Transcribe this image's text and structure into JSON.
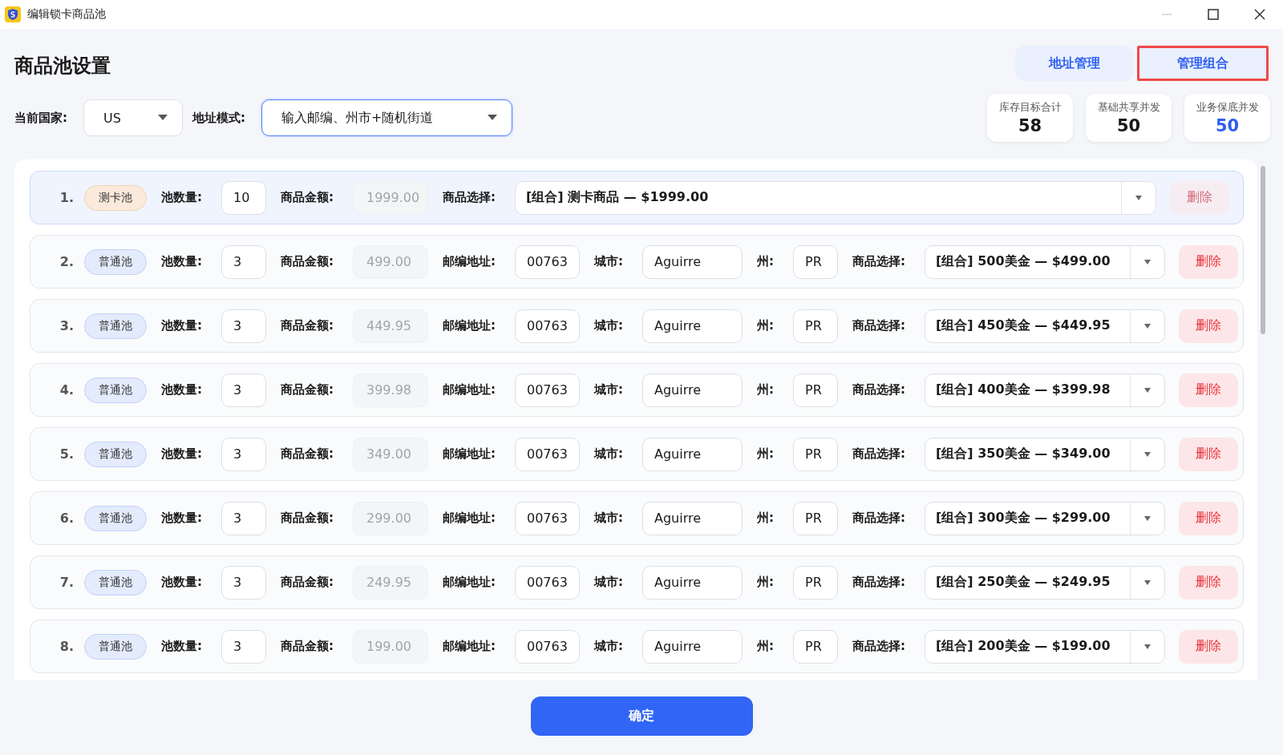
{
  "window": {
    "title": "编辑锁卡商品池"
  },
  "page": {
    "title": "商品池设置"
  },
  "header_buttons": [
    {
      "label": "地址管理",
      "highlighted": false
    },
    {
      "label": "管理组合",
      "highlighted": true
    }
  ],
  "filters": [
    {
      "label": "当前国家:",
      "value": "US",
      "focused": false,
      "kind": "short"
    },
    {
      "label": "地址模式:",
      "value": "输入邮编、州市+随机街道",
      "focused": true,
      "kind": "long"
    }
  ],
  "stats": [
    {
      "label": "库存目标合计",
      "value": "58",
      "accent": false
    },
    {
      "label": "基础共享并发",
      "value": "50",
      "accent": false
    },
    {
      "label": "业务保底并发",
      "value": "50",
      "accent": true
    }
  ],
  "rows": [
    {
      "index": "1.",
      "kind": "test",
      "tag": "测卡池",
      "selected": true,
      "qty_label": "池数量:",
      "qty": "10",
      "amount_label": "商品金额:",
      "amount": "1999.00",
      "product_label": "商品选择:",
      "product": "[组合] 测卡商品 — $1999.00",
      "delete": {
        "label": "删除",
        "disabled": true
      }
    },
    {
      "index": "2.",
      "kind": "normal",
      "tag": "普通池",
      "selected": false,
      "qty_label": "池数量:",
      "qty": "3",
      "amount_label": "商品金额:",
      "amount": "499.00",
      "zip_label": "邮编地址:",
      "zip": "00763",
      "city_label": "城市:",
      "city": "Aguirre",
      "state_label": "州:",
      "state": "PR",
      "product_label": "商品选择:",
      "product": "[组合] 500美金 — $499.00",
      "delete": {
        "label": "删除",
        "disabled": false
      }
    },
    {
      "index": "3.",
      "kind": "normal",
      "tag": "普通池",
      "selected": false,
      "qty_label": "池数量:",
      "qty": "3",
      "amount_label": "商品金额:",
      "amount": "449.95",
      "zip_label": "邮编地址:",
      "zip": "00763",
      "city_label": "城市:",
      "city": "Aguirre",
      "state_label": "州:",
      "state": "PR",
      "product_label": "商品选择:",
      "product": "[组合] 450美金 — $449.95",
      "delete": {
        "label": "删除",
        "disabled": false
      }
    },
    {
      "index": "4.",
      "kind": "normal",
      "tag": "普通池",
      "selected": false,
      "qty_label": "池数量:",
      "qty": "3",
      "amount_label": "商品金额:",
      "amount": "399.98",
      "zip_label": "邮编地址:",
      "zip": "00763",
      "city_label": "城市:",
      "city": "Aguirre",
      "state_label": "州:",
      "state": "PR",
      "product_label": "商品选择:",
      "product": "[组合] 400美金 — $399.98",
      "delete": {
        "label": "删除",
        "disabled": false
      }
    },
    {
      "index": "5.",
      "kind": "normal",
      "tag": "普通池",
      "selected": false,
      "qty_label": "池数量:",
      "qty": "3",
      "amount_label": "商品金额:",
      "amount": "349.00",
      "zip_label": "邮编地址:",
      "zip": "00763",
      "city_label": "城市:",
      "city": "Aguirre",
      "state_label": "州:",
      "state": "PR",
      "product_label": "商品选择:",
      "product": "[组合] 350美金 — $349.00",
      "delete": {
        "label": "删除",
        "disabled": false
      }
    },
    {
      "index": "6.",
      "kind": "normal",
      "tag": "普通池",
      "selected": false,
      "qty_label": "池数量:",
      "qty": "3",
      "amount_label": "商品金额:",
      "amount": "299.00",
      "zip_label": "邮编地址:",
      "zip": "00763",
      "city_label": "城市:",
      "city": "Aguirre",
      "state_label": "州:",
      "state": "PR",
      "product_label": "商品选择:",
      "product": "[组合] 300美金 — $299.00",
      "delete": {
        "label": "删除",
        "disabled": false
      }
    },
    {
      "index": "7.",
      "kind": "normal",
      "tag": "普通池",
      "selected": false,
      "qty_label": "池数量:",
      "qty": "3",
      "amount_label": "商品金额:",
      "amount": "249.95",
      "zip_label": "邮编地址:",
      "zip": "00763",
      "city_label": "城市:",
      "city": "Aguirre",
      "state_label": "州:",
      "state": "PR",
      "product_label": "商品选择:",
      "product": "[组合] 250美金 — $249.95",
      "delete": {
        "label": "删除",
        "disabled": false
      }
    },
    {
      "index": "8.",
      "kind": "normal",
      "tag": "普通池",
      "selected": false,
      "qty_label": "池数量:",
      "qty": "3",
      "amount_label": "商品金额:",
      "amount": "199.00",
      "zip_label": "邮编地址:",
      "zip": "00763",
      "city_label": "城市:",
      "city": "Aguirre",
      "state_label": "州:",
      "state": "PR",
      "product_label": "商品选择:",
      "product": "[组合] 200美金 — $199.00",
      "delete": {
        "label": "删除",
        "disabled": false
      }
    }
  ],
  "confirm_button": {
    "label": "确定"
  }
}
